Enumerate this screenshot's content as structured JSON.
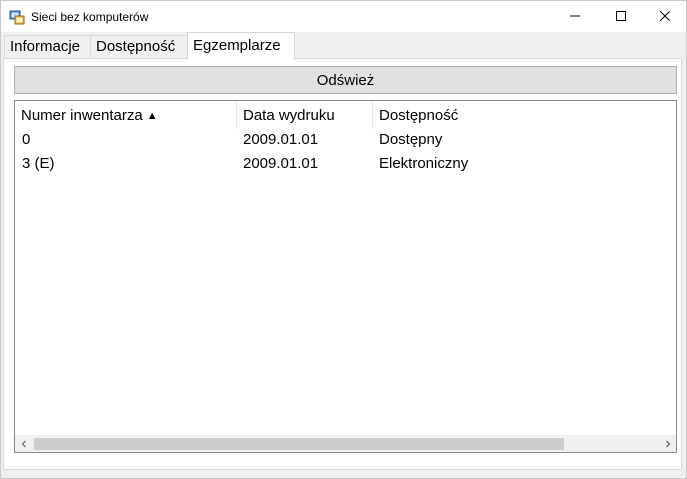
{
  "window": {
    "title": "Sieci bez komputerów",
    "minimize_icon": "minimize-icon",
    "maximize_icon": "maximize-icon",
    "close_icon": "close-icon"
  },
  "tabs": [
    {
      "label": "Informacje",
      "active": false
    },
    {
      "label": "Dostępność",
      "active": false
    },
    {
      "label": "Egzemplarze",
      "active": true
    }
  ],
  "refresh_button": {
    "label": "Odśwież"
  },
  "list": {
    "columns": [
      {
        "label": "Numer inwentarza",
        "sort": "ascending",
        "sort_icon": "sort-ascending-icon"
      },
      {
        "label": "Data wydruku"
      },
      {
        "label": "Dostępność"
      }
    ],
    "rows": [
      [
        "0",
        "2009.01.01",
        "Dostępny"
      ],
      [
        "3 (E)",
        "2009.01.01",
        "Elektroniczny"
      ]
    ]
  },
  "scrollbar": {
    "left_icon": "chevron-left-icon",
    "right_icon": "chevron-right-icon"
  }
}
